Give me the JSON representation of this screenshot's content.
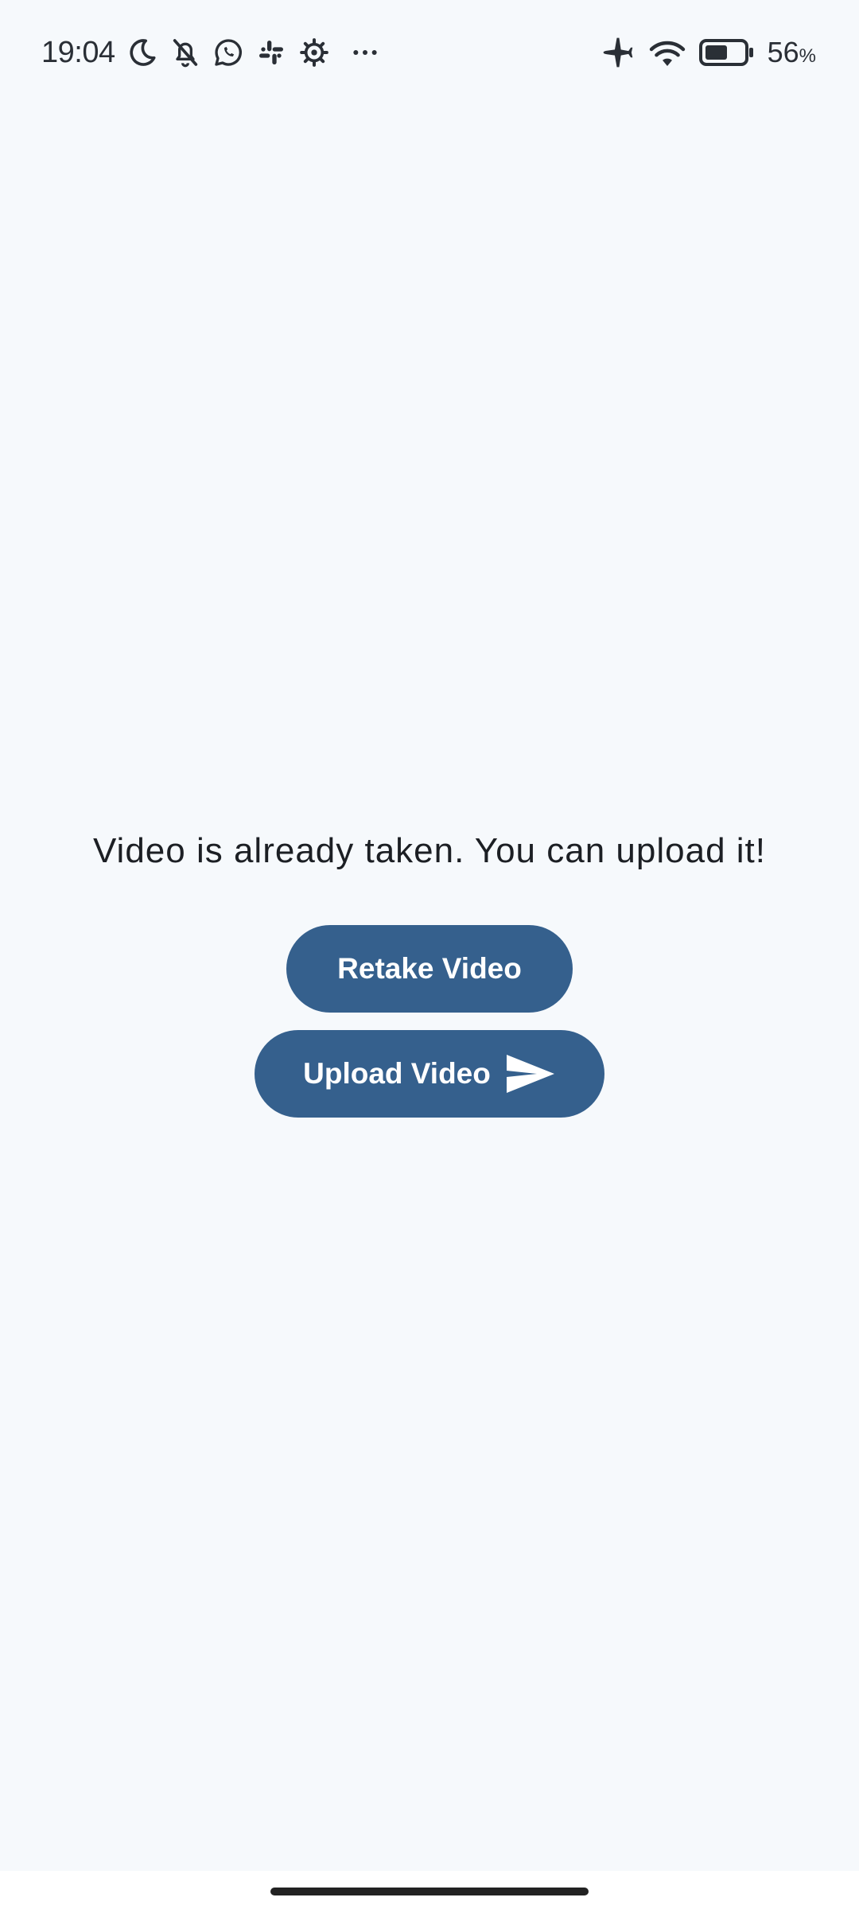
{
  "status_bar": {
    "time": "19:04",
    "battery_level": "56",
    "battery_unit": "%",
    "icons_left": [
      "moon-icon",
      "bell-off-icon",
      "whatsapp-icon",
      "slack-icon",
      "gear-icon",
      "more-dots-icon"
    ],
    "icons_right": [
      "airplane-icon",
      "wifi-icon",
      "battery-icon"
    ]
  },
  "main": {
    "message": "Video is already taken. You can upload it!",
    "retake_label": "Retake Video",
    "upload_label": "Upload Video",
    "upload_icon": "send-icon"
  },
  "colors": {
    "background": "#f6f9fc",
    "button": "#35608d",
    "button_text": "#ffffff",
    "text": "#1c1f24"
  }
}
